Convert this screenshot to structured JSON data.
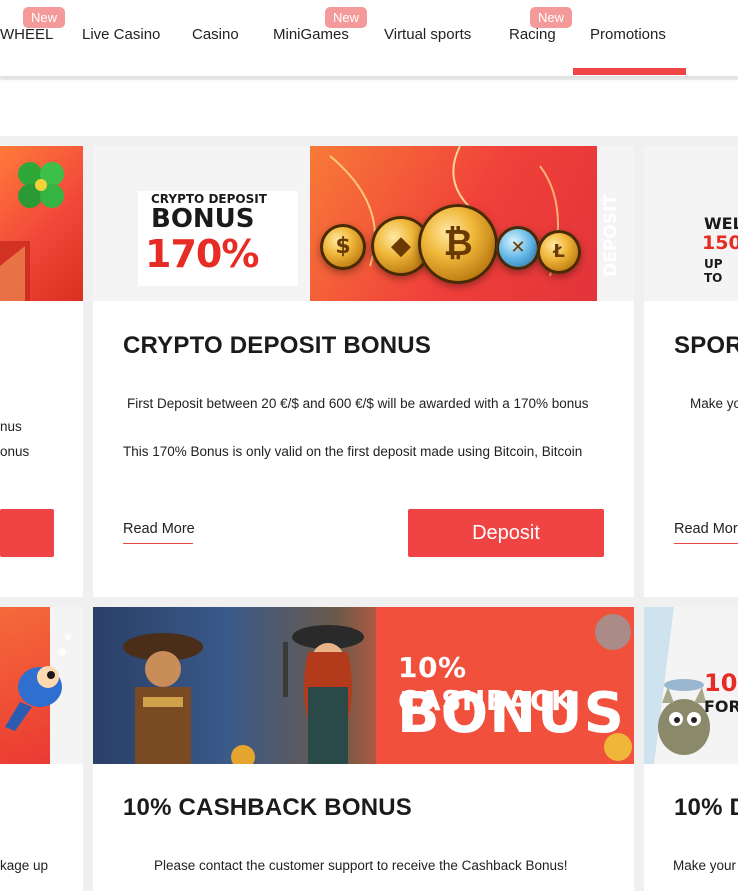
{
  "nav": {
    "items": [
      {
        "label": "WHEEL"
      },
      {
        "label": "Live Casino"
      },
      {
        "label": "Casino"
      },
      {
        "label": "MiniGames"
      },
      {
        "label": "Virtual sports"
      },
      {
        "label": "Racing"
      },
      {
        "label": "Promotions"
      }
    ],
    "badge": "New",
    "active": "Promotions"
  },
  "colors": {
    "accent": "#f04545",
    "badge": "#f49a9a",
    "page_bg": "#f0f0f0"
  },
  "cards": {
    "left_top": {
      "text_lines": [
        "nus",
        "onus"
      ]
    },
    "crypto": {
      "banner_lines": [
        "CRYPTO DEPOSIT",
        "BONUS",
        "170%"
      ],
      "banner_side": "DEPOSIT",
      "title": "CRYPTO DEPOSIT BONUS",
      "text_1": "First Deposit between 20 €/$ and 600 €/$ will be awarded with a 170% bonus",
      "text_2": "This 170% Bonus is only valid on the first deposit made using Bitcoin, Bitcoin",
      "read_more": "Read More",
      "button": "Deposit"
    },
    "right_top": {
      "banner_lines": [
        "WEL",
        "150",
        "UP TO"
      ],
      "title": "SPOR",
      "text": "Make yo",
      "read_more": "Read More"
    },
    "left_bottom": {
      "text": "kage up"
    },
    "cashback": {
      "banner_lines": [
        "10% CASHBACK",
        "BONUS"
      ],
      "title": "10% CASHBACK BONUS",
      "text": "Please contact the customer support to receive the Cashback Bonus!"
    },
    "right_bottom": {
      "banner_lines": [
        "10",
        "FOR"
      ],
      "title": "10% D",
      "text": "Make your"
    }
  }
}
